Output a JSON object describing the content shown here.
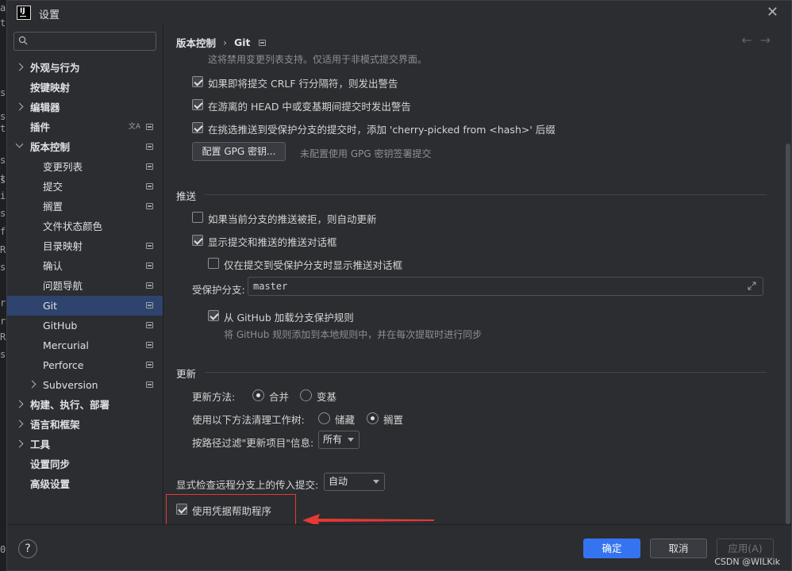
{
  "window": {
    "title": "设置",
    "logo_text": "IJ"
  },
  "outside_gutter": [
    "a",
    "t",
    "s",
    "s",
    "t",
    "s",
    "s",
    "t",
    "i",
    "s",
    "f",
    "R",
    "s",
    "r",
    "r",
    "R",
    "s",
    "0"
  ],
  "search": {
    "placeholder": ""
  },
  "sidebar": {
    "items": [
      {
        "label": "外观与行为",
        "bold": true,
        "level": 0,
        "chevron": "right",
        "proj": false
      },
      {
        "label": "按键映射",
        "bold": true,
        "level": 0,
        "chevron": "",
        "proj": false
      },
      {
        "label": "编辑器",
        "bold": true,
        "level": 0,
        "chevron": "right",
        "proj": false
      },
      {
        "label": "插件",
        "bold": true,
        "level": 0,
        "chevron": "",
        "proj": true,
        "translate": true
      },
      {
        "label": "版本控制",
        "bold": true,
        "level": 0,
        "chevron": "down",
        "proj": true
      },
      {
        "label": "变更列表",
        "bold": false,
        "level": 1,
        "chevron": "",
        "proj": true
      },
      {
        "label": "提交",
        "bold": false,
        "level": 1,
        "chevron": "",
        "proj": true
      },
      {
        "label": "搁置",
        "bold": false,
        "level": 1,
        "chevron": "",
        "proj": true
      },
      {
        "label": "文件状态颜色",
        "bold": false,
        "level": 1,
        "chevron": "",
        "proj": false
      },
      {
        "label": "目录映射",
        "bold": false,
        "level": 1,
        "chevron": "",
        "proj": true
      },
      {
        "label": "确认",
        "bold": false,
        "level": 1,
        "chevron": "",
        "proj": true
      },
      {
        "label": "问题导航",
        "bold": false,
        "level": 1,
        "chevron": "",
        "proj": true
      },
      {
        "label": "Git",
        "bold": false,
        "level": 1,
        "chevron": "",
        "proj": true,
        "selected": true
      },
      {
        "label": "GitHub",
        "bold": false,
        "level": 1,
        "chevron": "",
        "proj": true
      },
      {
        "label": "Mercurial",
        "bold": false,
        "level": 1,
        "chevron": "",
        "proj": true
      },
      {
        "label": "Perforce",
        "bold": false,
        "level": 1,
        "chevron": "",
        "proj": true
      },
      {
        "label": "Subversion",
        "bold": false,
        "level": 1,
        "chevron": "right",
        "proj": true
      },
      {
        "label": "构建、执行、部署",
        "bold": true,
        "level": 0,
        "chevron": "right",
        "proj": false
      },
      {
        "label": "语言和框架",
        "bold": true,
        "level": 0,
        "chevron": "right",
        "proj": false
      },
      {
        "label": "工具",
        "bold": true,
        "level": 0,
        "chevron": "right",
        "proj": false
      },
      {
        "label": "设置同步",
        "bold": true,
        "level": 0,
        "chevron": "",
        "proj": false
      },
      {
        "label": "高级设置",
        "bold": true,
        "level": 0,
        "chevron": "",
        "proj": false
      }
    ]
  },
  "breadcrumb": {
    "parent": "版本控制",
    "separator": "›",
    "current": "Git"
  },
  "nav": {
    "back": "←",
    "forward": "→"
  },
  "main": {
    "top_hint": "这将禁用变更列表支持。仅适用于非模式提交界面。",
    "opt_crlf": {
      "label": "如果即将提交 CRLF 行分隔符，则发出警告",
      "checked": true
    },
    "opt_detached": {
      "label": "在游离的 HEAD 中或变基期间提交时发出警告",
      "checked": true
    },
    "opt_cherry": {
      "label": "在挑选推送到受保护分支的提交时，添加 'cherry-picked from <hash>' 后缀",
      "checked": true
    },
    "gpg_button": "配置 GPG 密钥...",
    "gpg_hint": "未配置使用 GPG 密钥签署提交",
    "push_section": "推送",
    "opt_auto_update": {
      "label": "如果当前分支的推送被拒，则自动更新",
      "checked": false
    },
    "opt_show_push": {
      "label": "显示提交和推送的推送对话框",
      "checked": true
    },
    "opt_protected_only": {
      "label": "仅在提交到受保护分支时显示推送对话框",
      "checked": false
    },
    "protected_label": "受保护分支:",
    "protected_value": "master",
    "opt_github_rules": {
      "label": "从 GitHub 加载分支保护规则",
      "checked": true
    },
    "github_rules_hint": "将 GitHub 规则添加到本地规则中，并在每次提取时进行同步",
    "update_section": "更新",
    "update_method_label": "更新方法:",
    "update_merge": "合并",
    "update_rebase": "变基",
    "clean_label": "使用以下方法清理工作树:",
    "clean_stash": "储藏",
    "clean_shelve": "搁置",
    "filter_label": "按路径过滤\"更新项目\"信息:",
    "filter_value": "所有",
    "incoming_label": "显式检查远程分支上的传入提交:",
    "incoming_value": "自动",
    "opt_credential": {
      "label": "使用凭据帮助程序",
      "checked": true
    }
  },
  "footer": {
    "help": "?",
    "ok": "确定",
    "cancel": "取消",
    "apply": "应用(A)",
    "watermark": "CSDN @WILKik"
  },
  "colors": {
    "accent": "#3574f0",
    "selection": "#2e436e",
    "annotation": "#e53935"
  }
}
